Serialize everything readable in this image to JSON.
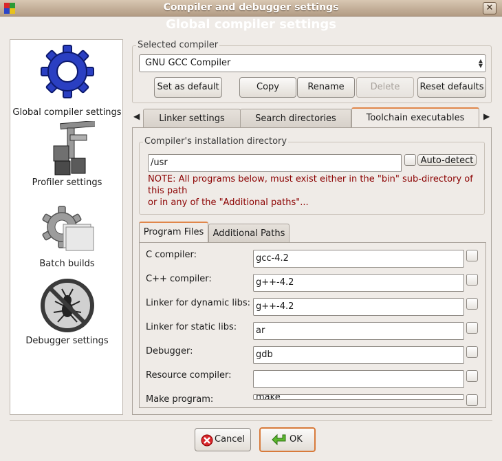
{
  "window": {
    "title": "Compiler and debugger settings",
    "close_glyph": "✕"
  },
  "banner": "Global compiler settings",
  "sidebar": {
    "items": [
      {
        "label": "Global compiler settings",
        "icon": "gear-icon"
      },
      {
        "label": "Profiler settings",
        "icon": "profiler-icon"
      },
      {
        "label": "Batch builds",
        "icon": "batch-builds-icon"
      },
      {
        "label": "Debugger settings",
        "icon": "debugger-bug-icon"
      }
    ]
  },
  "selected_compiler": {
    "group_label": "Selected compiler",
    "value": "GNU GCC Compiler",
    "buttons": {
      "set_default": "Set as default",
      "copy": "Copy",
      "rename": "Rename",
      "delete": "Delete",
      "reset": "Reset defaults"
    }
  },
  "tabs": [
    "Linker settings",
    "Search directories",
    "Toolchain executables"
  ],
  "active_tab": "Toolchain executables",
  "install_dir": {
    "group_label": "Compiler's installation directory",
    "value": "/usr",
    "autodetect_label": "Auto-detect",
    "note_lines": [
      "NOTE: All programs below, must exist either in the \"bin\" sub-directory of",
      "this path",
      "or in any of the \"Additional paths\"..."
    ]
  },
  "inner_tabs": [
    "Program Files",
    "Additional Paths"
  ],
  "program_files": [
    {
      "label": "C compiler:",
      "value": "gcc-4.2"
    },
    {
      "label": "C++ compiler:",
      "value": "g++-4.2"
    },
    {
      "label": "Linker for dynamic libs:",
      "value": "g++-4.2"
    },
    {
      "label": "Linker for static libs:",
      "value": "ar"
    },
    {
      "label": "Debugger:",
      "value": "gdb"
    },
    {
      "label": "Resource compiler:",
      "value": ""
    },
    {
      "label": "Make program:",
      "value": "make"
    }
  ],
  "dialog_buttons": {
    "cancel": "Cancel",
    "ok": "OK"
  },
  "colors": {
    "note": "#8b0000",
    "accent": "#e0864a",
    "title_bar": "#c4ae96"
  }
}
